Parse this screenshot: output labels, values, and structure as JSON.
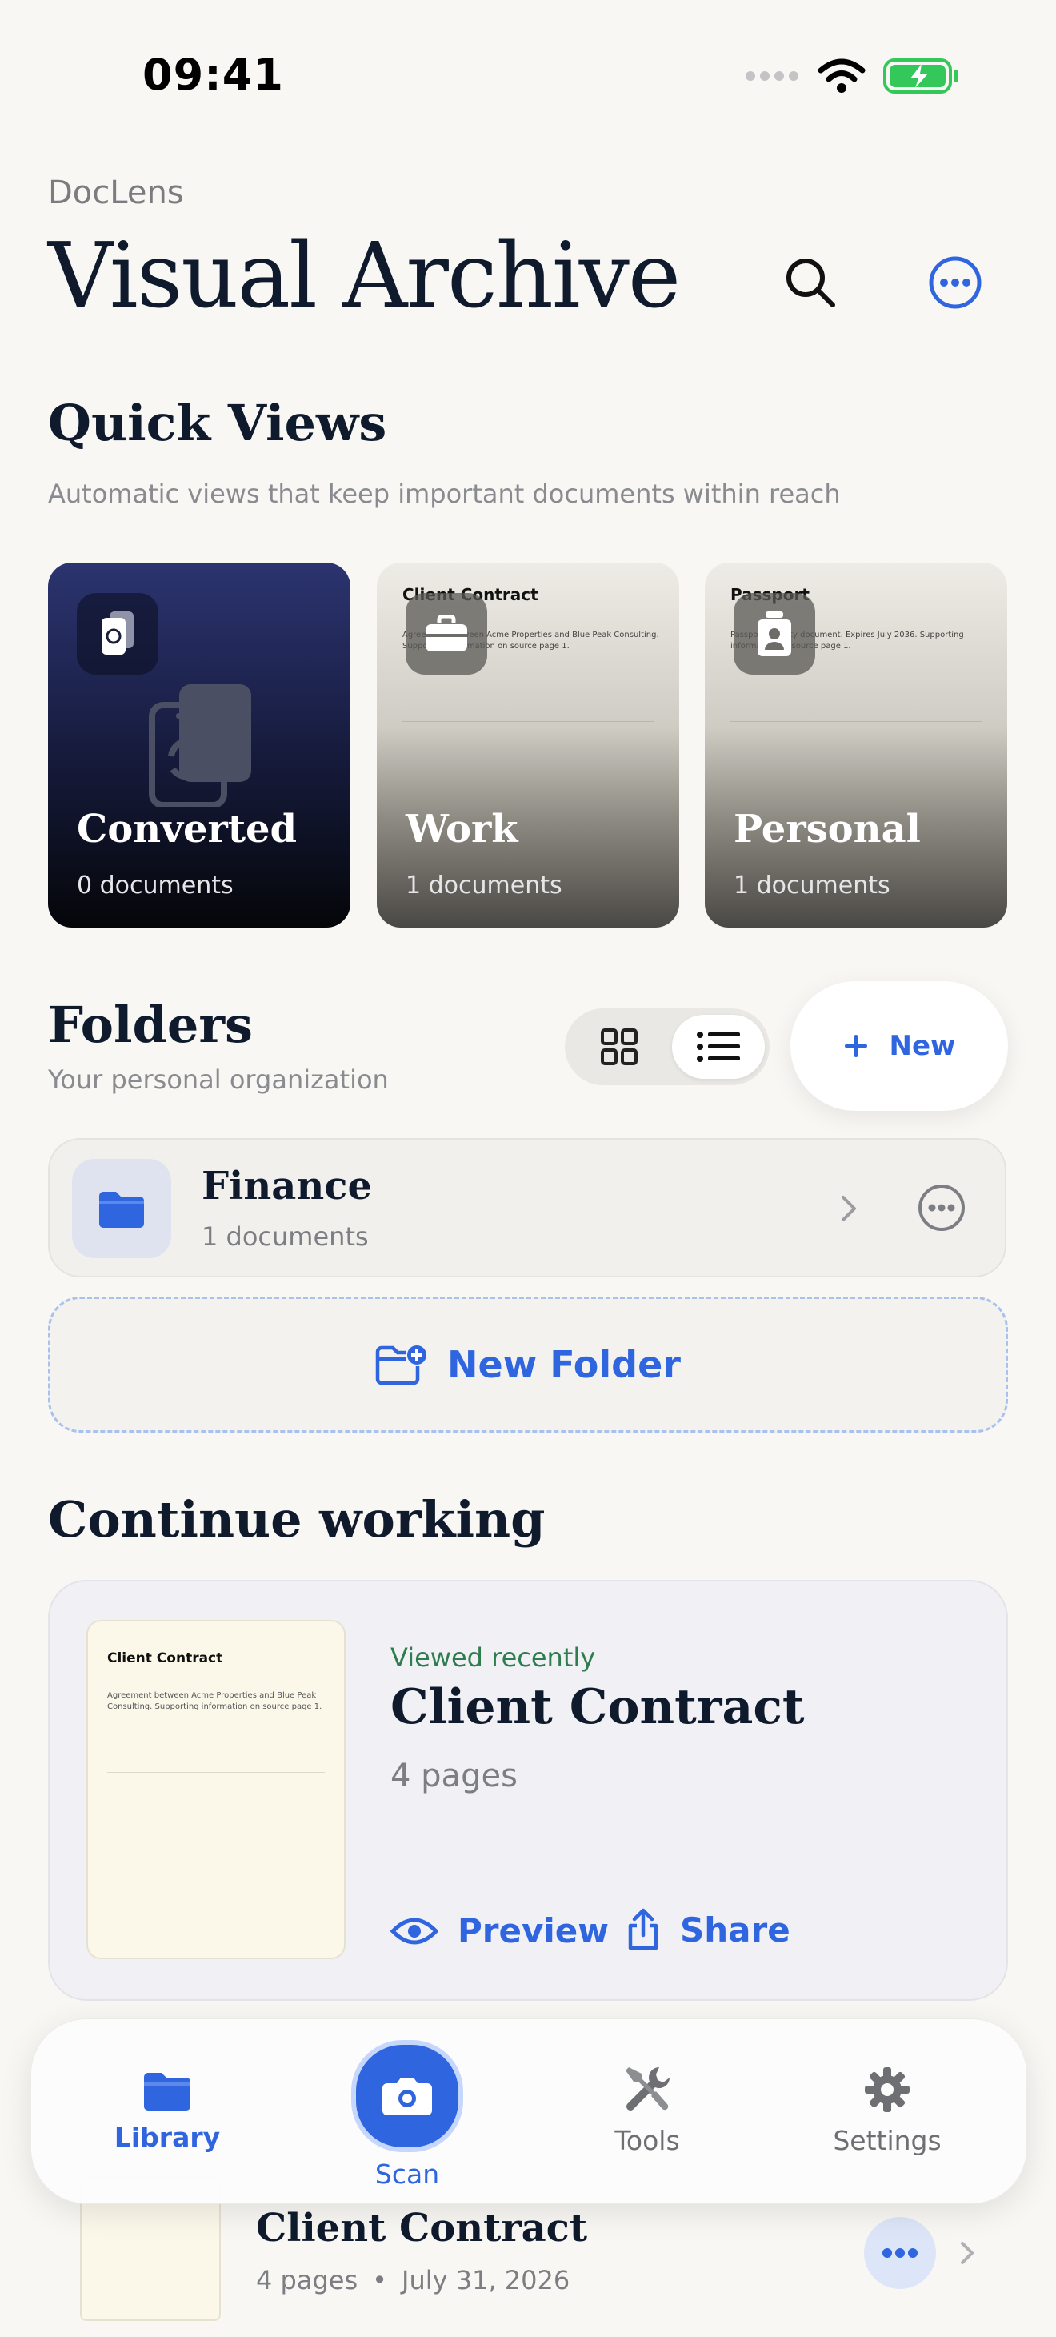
{
  "status_bar": {
    "time": "09:41"
  },
  "header": {
    "app_name": "DocLens",
    "title": "Visual Archive"
  },
  "quick_views": {
    "title": "Quick Views",
    "subtitle": "Automatic views that keep important documents within reach",
    "cards": [
      {
        "name": "Converted",
        "count": "0 documents"
      },
      {
        "name": "Work",
        "count": "1 documents",
        "doc_title": "Client Contract",
        "doc_snippet": "Agreement between Acme Properties and Blue Peak Consulting. Supporting information on source page 1."
      },
      {
        "name": "Personal",
        "count": "1 documents",
        "doc_title": "Passport",
        "doc_snippet": "Passport identity document. Expires July 2036. Supporting information on source page 1."
      }
    ]
  },
  "folders": {
    "title": "Folders",
    "subtitle": "Your personal organization",
    "new_label": "New",
    "items": [
      {
        "name": "Finance",
        "count": "1 documents"
      }
    ],
    "new_folder_label": "New Folder"
  },
  "continue_working": {
    "title": "Continue working",
    "status": "Viewed recently",
    "doc_title": "Client Contract",
    "pages": "4 pages",
    "thumb_title": "Client Contract",
    "thumb_snippet": "Agreement between Acme Properties and Blue Peak Consulting. Supporting information on source page 1.",
    "preview_label": "Preview",
    "share_label": "Share"
  },
  "recent": {
    "doc_title": "Client Contract",
    "pages": "4 pages",
    "date": "July 31, 2026"
  },
  "tabbar": {
    "library": "Library",
    "scan": "Scan",
    "tools": "Tools",
    "settings": "Settings"
  },
  "colors": {
    "accent": "#2f66e0",
    "text": "#0f1b2d",
    "success": "#2e7d4f",
    "background": "#f8f7f4"
  }
}
